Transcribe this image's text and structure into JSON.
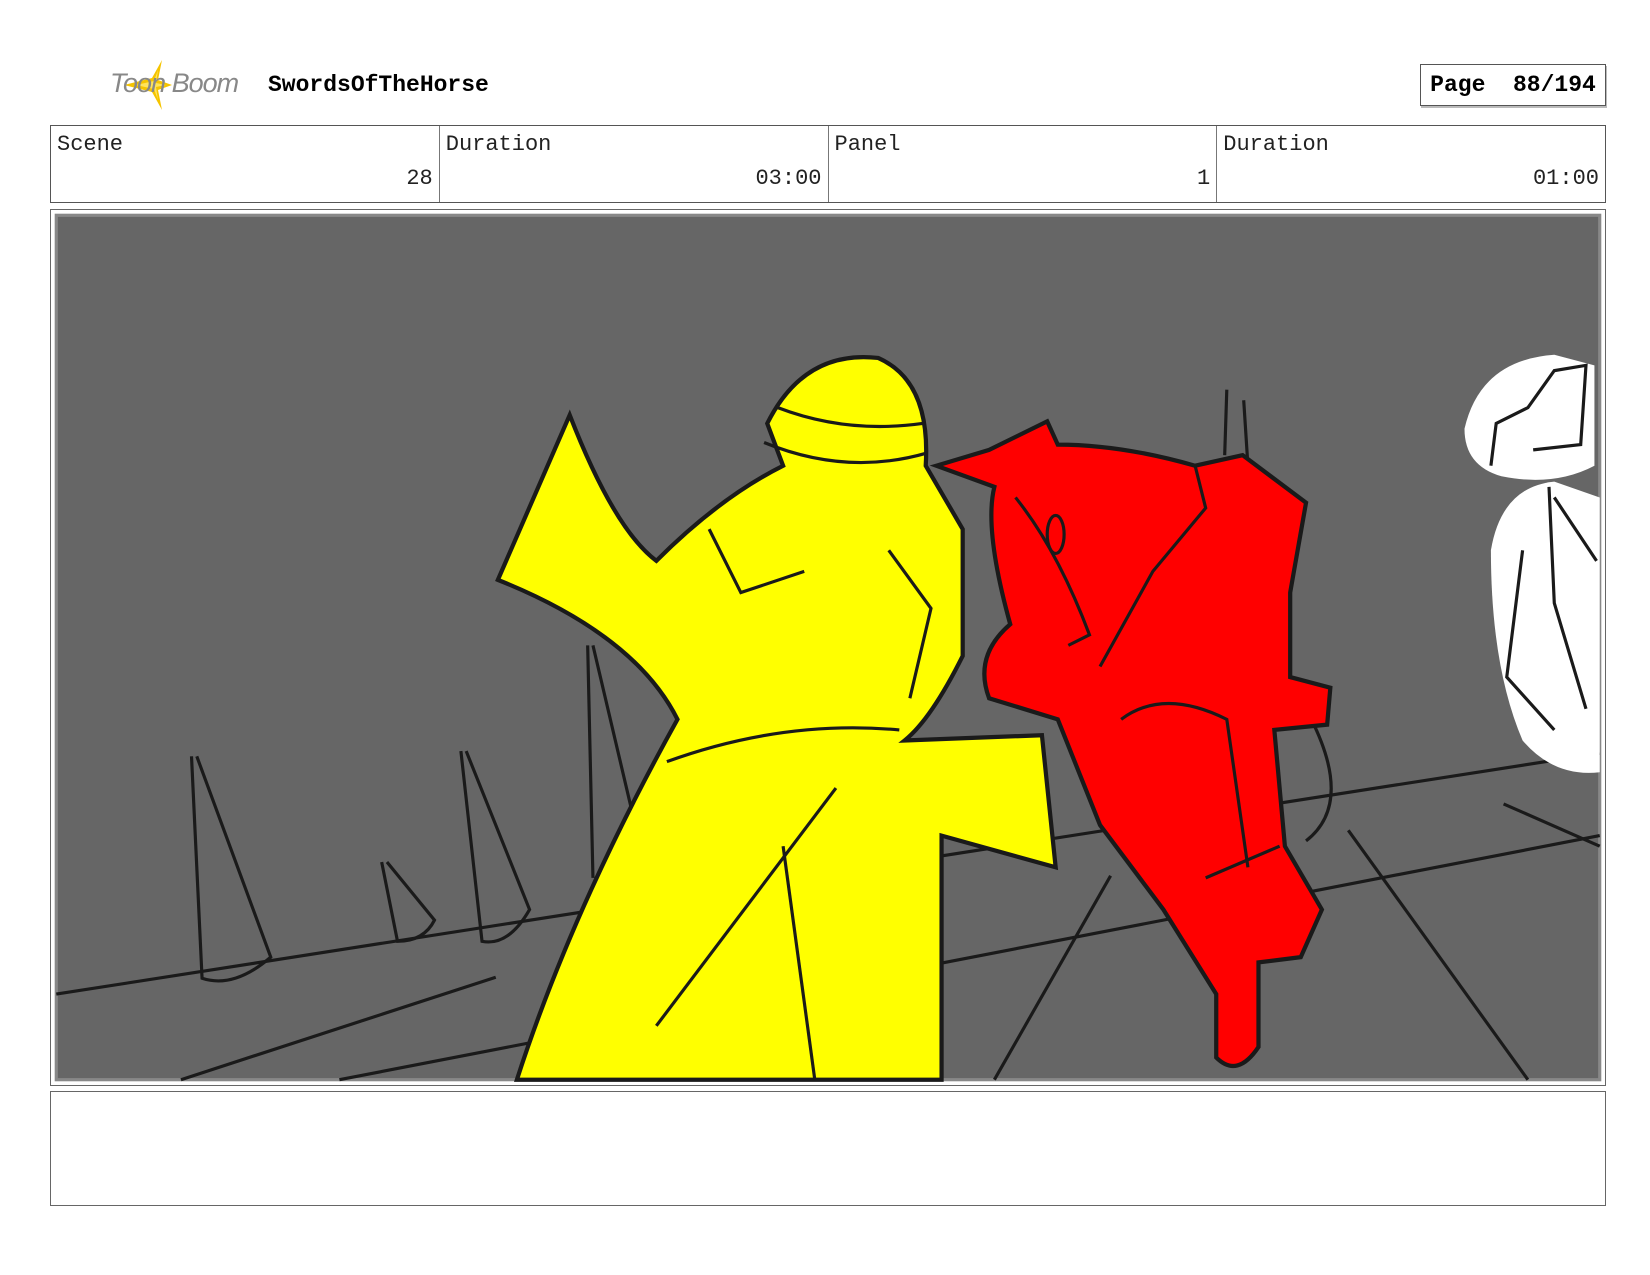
{
  "header": {
    "brand": "Toon Boom",
    "project": "SwordsOfTheHorse",
    "page_label": "Page",
    "page": "88/194"
  },
  "fields": [
    {
      "label": "Scene",
      "value": "28"
    },
    {
      "label": "Duration",
      "value": "03:00"
    },
    {
      "label": "Panel",
      "value": "1"
    },
    {
      "label": "Duration",
      "value": "01:00"
    }
  ],
  "panel": {
    "background": "#666666",
    "colors": {
      "yellow": "#ffff00",
      "red": "#ff0000",
      "white": "#ffffff"
    }
  },
  "notes": ""
}
